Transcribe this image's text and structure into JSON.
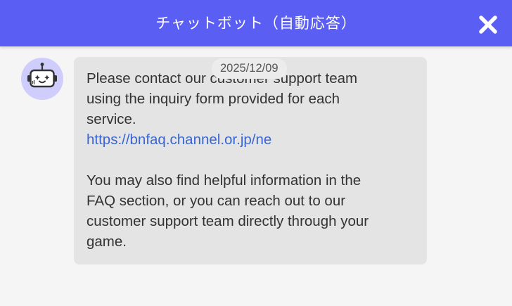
{
  "header": {
    "title": "チャットボット（自動応答）",
    "close_icon": "close-icon",
    "background_color": "#5b5ef2"
  },
  "chat": {
    "date": "2025/12/09",
    "avatar_icon": "robot-icon",
    "message": {
      "line1": "Please contact our customer support team",
      "line2": "using the inquiry form provided for each",
      "line3": "service.",
      "link": "https://bnfaq.channel.or.jp/ne",
      "line4": "You may also find helpful information in the",
      "line5": "FAQ section, or you can reach out to our",
      "line6": "customer support team directly through your",
      "line7": "game."
    },
    "link_color": "#3a66d1",
    "bubble_color": "#e4e4e4"
  }
}
